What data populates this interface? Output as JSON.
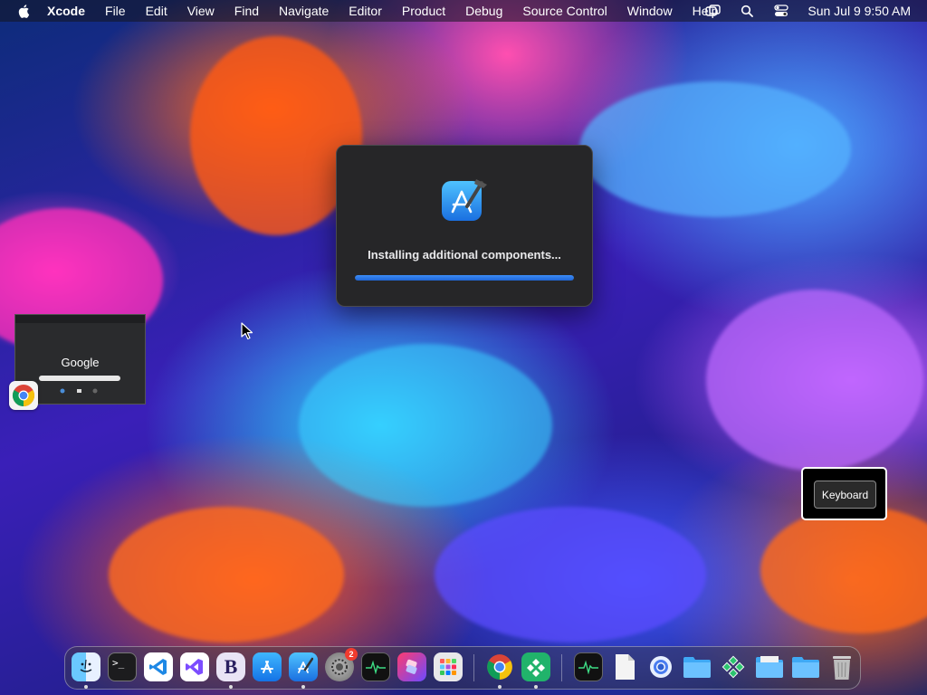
{
  "menubar": {
    "app_name": "Xcode",
    "items": [
      "File",
      "Edit",
      "View",
      "Find",
      "Navigate",
      "Editor",
      "Product",
      "Debug",
      "Source Control",
      "Window",
      "Help"
    ],
    "status_icons": [
      "screen-mirroring-icon",
      "spotlight-search-icon",
      "control-center-icon"
    ],
    "clock": "Sun Jul 9  9:50 AM"
  },
  "dialog": {
    "message": "Installing additional components...",
    "progress": 1.0,
    "icon": "xcode-icon"
  },
  "thumbnail": {
    "logo_text": "Google",
    "app_icon": "chrome-icon"
  },
  "keyboard_hud": {
    "label": "Keyboard"
  },
  "dock": {
    "apps": [
      {
        "name": "finder-icon",
        "running": true
      },
      {
        "name": "terminal-icon",
        "running": false
      },
      {
        "name": "vscode-icon",
        "running": false
      },
      {
        "name": "visual-studio-icon",
        "running": false
      },
      {
        "name": "bbedit-icon",
        "running": true
      },
      {
        "name": "app-store-icon",
        "running": false
      },
      {
        "name": "xcode-icon",
        "running": true
      },
      {
        "name": "system-settings-icon",
        "running": false,
        "badge": "2"
      },
      {
        "name": "activity-monitor-icon",
        "running": false
      },
      {
        "name": "shortcuts-icon",
        "running": false
      },
      {
        "name": "launchpad-icon",
        "running": false
      },
      {
        "name": "chrome-icon",
        "running": true
      },
      {
        "name": "green-diamond-app-icon",
        "running": true
      },
      {
        "name": "activity-monitor-doc-icon",
        "running": false
      },
      {
        "name": "document-icon",
        "running": false
      },
      {
        "name": "chrome-dev-icon",
        "running": false
      },
      {
        "name": "folder-icon",
        "running": false
      },
      {
        "name": "green-diamond-doc-icon",
        "running": false
      },
      {
        "name": "folder-icon",
        "running": false
      },
      {
        "name": "folder-icon",
        "running": false
      },
      {
        "name": "trash-icon",
        "running": false
      }
    ]
  },
  "colors": {
    "accent": "#1f66d8",
    "dialog_bg": "#262628",
    "badge": "#f23b2f"
  }
}
